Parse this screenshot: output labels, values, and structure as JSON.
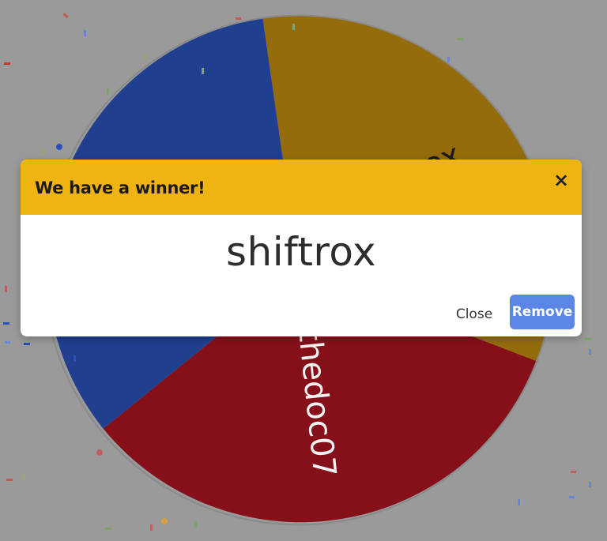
{
  "wheel": {
    "entries": [
      {
        "label": "shiftrox",
        "color": "#946c0c"
      },
      {
        "label": "thedoc07",
        "color": "#86101a"
      },
      {
        "label": "",
        "color": "#203f8f"
      }
    ]
  },
  "dialog": {
    "title": "We have a winner!",
    "close_icon": "×",
    "winner": "shiftrox",
    "close_label": "Close",
    "remove_label": "Remove"
  },
  "colors": {
    "overlay": "#9a9a9a",
    "header": "#efb312",
    "remove_button": "#5c86e6"
  }
}
